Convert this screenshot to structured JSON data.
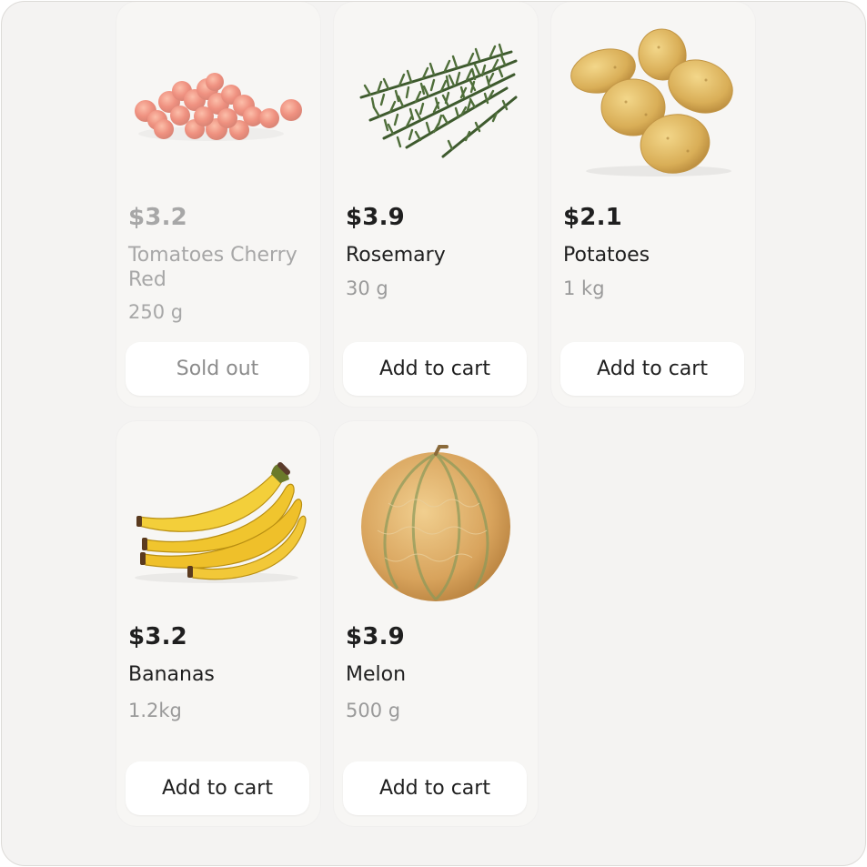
{
  "products": [
    {
      "price": "$3.2",
      "name": "Tomatoes Cherry Red",
      "weight": "250 g",
      "button": "Sold out",
      "image": "cherry-tomatoes",
      "sold_out": true
    },
    {
      "price": "$3.9",
      "name": "Rosemary",
      "weight": "30 g",
      "button": "Add to cart",
      "image": "rosemary",
      "sold_out": false
    },
    {
      "price": "$2.1",
      "name": "Potatoes",
      "weight": "1 kg",
      "button": "Add to cart",
      "image": "potatoes",
      "sold_out": false
    },
    {
      "price": "$3.2",
      "name": "Bananas",
      "weight": "1.2kg",
      "button": "Add to cart",
      "image": "bananas",
      "sold_out": false
    },
    {
      "price": "$3.9",
      "name": "Melon",
      "weight": "500 g",
      "button": "Add to cart",
      "image": "melon",
      "sold_out": false
    }
  ],
  "colors": {
    "background": "#f4f3f2",
    "card": "#f7f6f4",
    "button": "#ffffff",
    "text": "#1f1f1f",
    "muted": "#9a9a9a"
  }
}
